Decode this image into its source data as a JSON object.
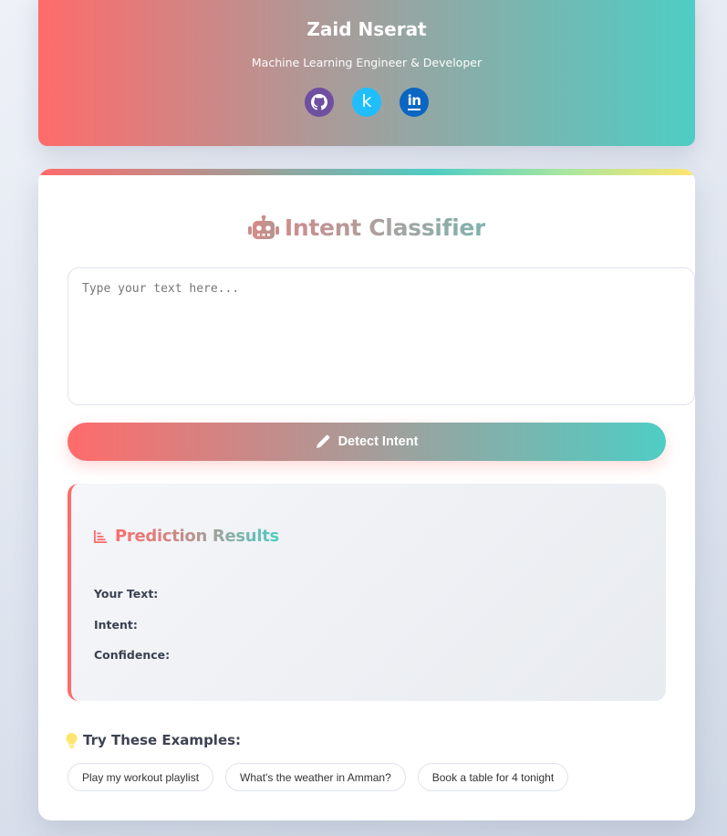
{
  "profile": {
    "name": "Zaid Nserat",
    "role": "Machine Learning Engineer & Developer",
    "social": [
      {
        "icon": "github-icon",
        "color": "#6e4fa0"
      },
      {
        "icon": "kaggle-icon",
        "label": "k",
        "color": "#20beff"
      },
      {
        "icon": "linkedin-icon",
        "label": "in",
        "color": "#0a66c2"
      }
    ]
  },
  "classifier": {
    "title": "Intent Classifier",
    "title_icon": "robot-icon",
    "input": {
      "value": "",
      "placeholder": "Type your text here..."
    },
    "detect_button": {
      "label": "Detect Intent",
      "icon": "pencil-icon"
    }
  },
  "results": {
    "heading_icon": "bar-chart-icon",
    "heading": "Prediction Results",
    "your_text_label": "Your Text:",
    "your_text_value": "",
    "intent_label": "Intent:",
    "intent_value": "",
    "confidence_label": "Confidence:",
    "confidence_value": ""
  },
  "examples": {
    "heading_icon": "lightbulb-icon",
    "heading": "Try These Examples:",
    "items": [
      "Play my workout playlist",
      "What's the weather in Amman?",
      "Book a table for 4 tonight"
    ]
  },
  "colors": {
    "coral": "#ff6b6b",
    "teal": "#4ecdc4",
    "yellow": "#ffe66d"
  }
}
